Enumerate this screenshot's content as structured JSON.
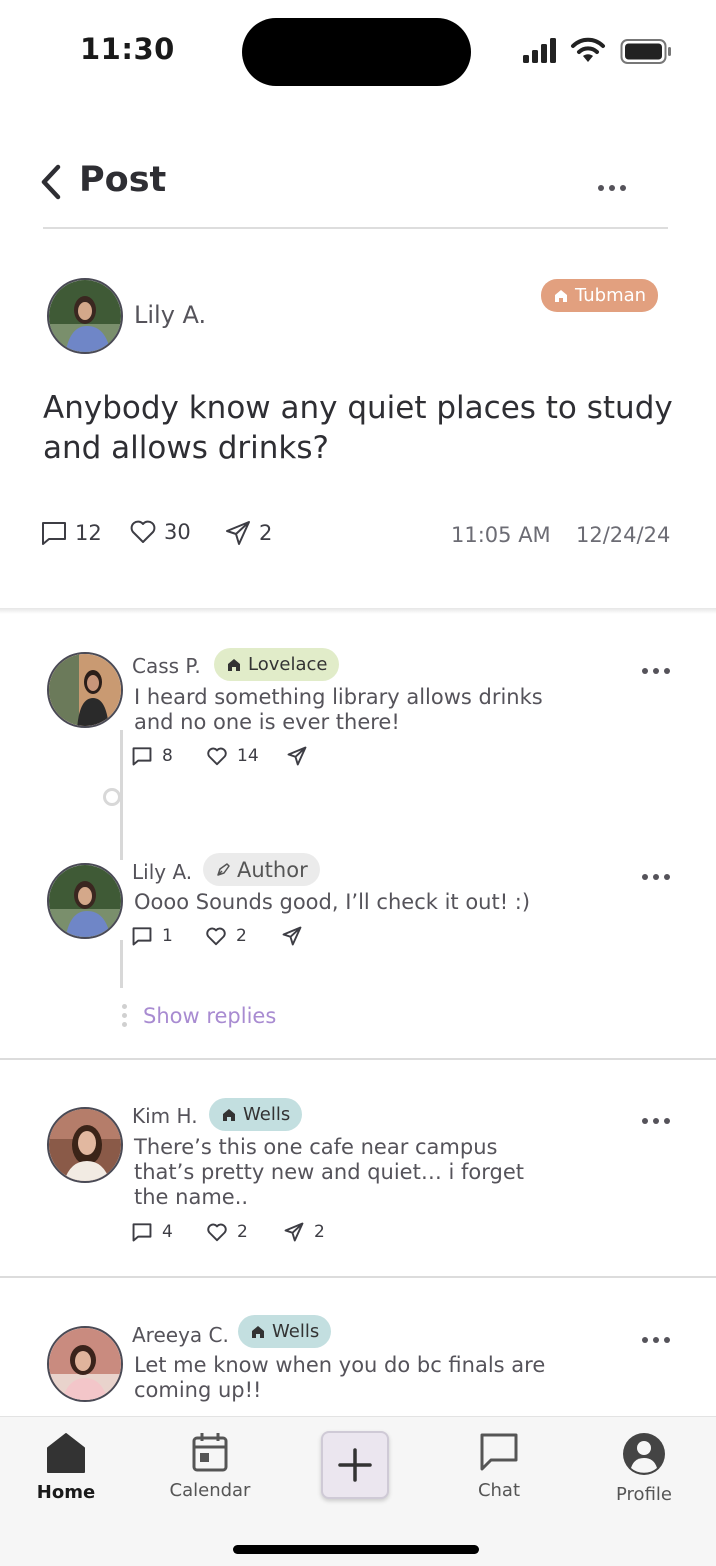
{
  "status_bar": {
    "time": "11:30"
  },
  "header": {
    "title": "Post"
  },
  "post": {
    "author": "Lily A.",
    "dorm_tag": "Tubman",
    "text": "Anybody know any quiet places to study and allows drinks?",
    "comments": "12",
    "likes": "30",
    "shares": "2",
    "time": "11:05 AM",
    "date": "12/24/24"
  },
  "comments": [
    {
      "name": "Cass P.",
      "tag": "Lovelace",
      "tag_color": "#e1ecc9",
      "text": "I heard something library allows drinks and no one is ever there!",
      "replies": "8",
      "likes": "14",
      "shares": ""
    },
    {
      "name": "Lily A.",
      "tag": "Author",
      "tag_color": "#ebebeb",
      "text": "Oooo Sounds good, I’ll check it out! :)",
      "replies": "1",
      "likes": "2",
      "shares": ""
    },
    {
      "name": "Kim H.",
      "tag": "Wells",
      "tag_color": "#c3dfe0",
      "text": "There’s this one cafe near campus that’s pretty new and quiet… i forget the name..",
      "replies": "4",
      "likes": "2",
      "shares": "2"
    },
    {
      "name": "Areeya C.",
      "tag": "Wells",
      "tag_color": "#c3dfe0",
      "text": "Let me know when you do bc finals are coming up!!",
      "replies": "",
      "likes": "",
      "shares": ""
    }
  ],
  "show_replies": "Show replies",
  "tabs": [
    {
      "label": "Home",
      "icon": "home-icon",
      "active": true
    },
    {
      "label": "Calendar",
      "icon": "calendar-icon",
      "active": false
    },
    {
      "label": "",
      "icon": "plus-icon",
      "active": false
    },
    {
      "label": "Chat",
      "icon": "chat-icon",
      "active": false
    },
    {
      "label": "Profile",
      "icon": "profile-icon",
      "active": false
    }
  ]
}
